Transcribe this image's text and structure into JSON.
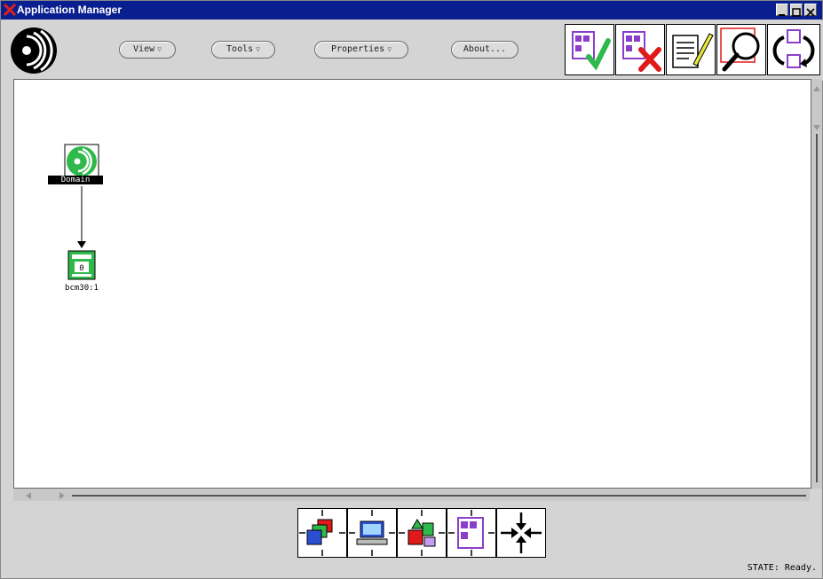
{
  "window": {
    "title": "Application Manager"
  },
  "toolbar": {
    "menus": [
      {
        "label": "View",
        "has_dropdown": true
      },
      {
        "label": "Tools",
        "has_dropdown": true
      },
      {
        "label": "Properties",
        "has_dropdown": true
      },
      {
        "label": "About...",
        "has_dropdown": false
      }
    ],
    "tool_icons": [
      "check-icon",
      "delete-icon",
      "edit-icon",
      "zoom-icon",
      "refresh-icon"
    ]
  },
  "canvas": {
    "nodes": [
      {
        "label": "Domain",
        "icon": "domain-icon",
        "selected": true
      },
      {
        "label": "bcm30:1",
        "icon": "bcm-icon",
        "selected": false
      }
    ]
  },
  "palette": {
    "icons": [
      "windows-stack-icon",
      "computer-icon",
      "shapes-icon",
      "grid-doc-icon",
      "collapse-arrows-icon"
    ]
  },
  "status": {
    "text": "STATE: Ready."
  },
  "colors": {
    "titlebar": "#0a1f8f",
    "accent_green": "#2fb94a",
    "accent_purple": "#8b3fc8",
    "accent_red": "#e01a1a"
  }
}
